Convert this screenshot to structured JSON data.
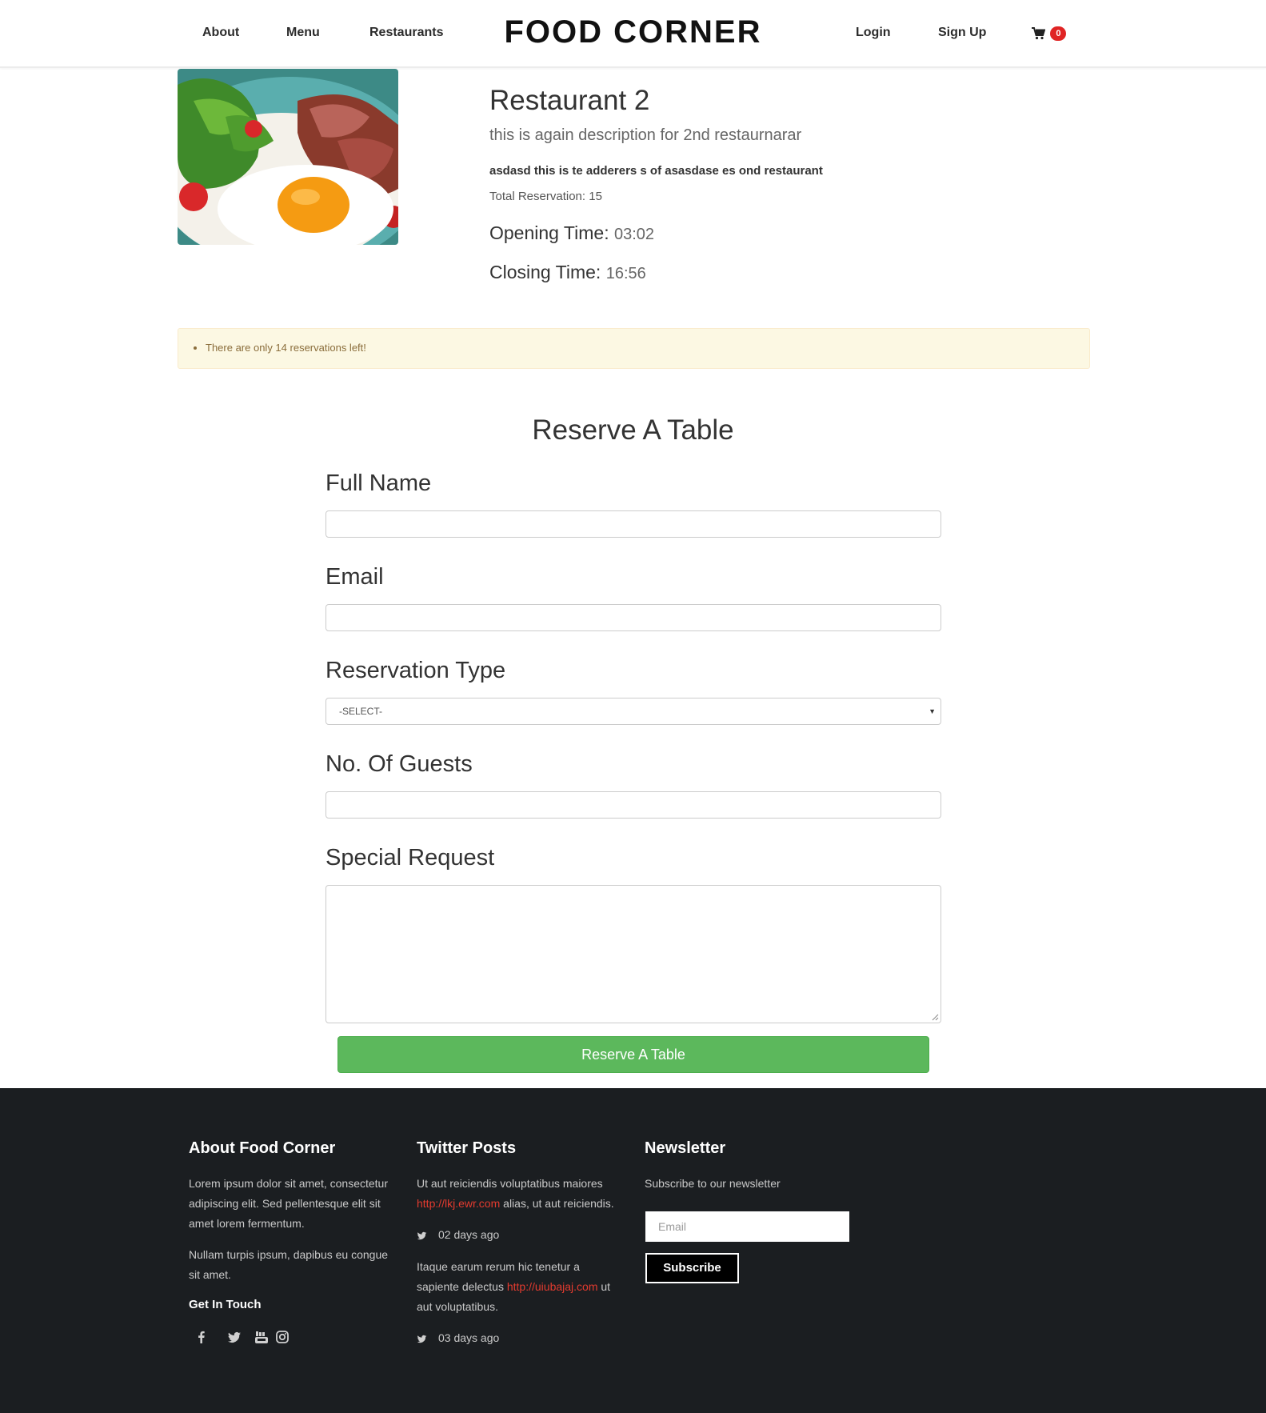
{
  "header": {
    "brand": "FOOD CORNER",
    "nav": {
      "about": "About",
      "menu": "Menu",
      "restaurants": "Restaurants",
      "login": "Login",
      "signup": "Sign Up"
    },
    "cart_count": "0"
  },
  "restaurant": {
    "name": "Restaurant 2",
    "description": "this is again description for 2nd restaurnarar",
    "address": "asdasd this is te adderers s of asasdase es ond restaurant",
    "total_reservation": "Total Reservation: 15",
    "opening_label": "Opening Time:",
    "opening_value": "03:02",
    "closing_label": "Closing Time:",
    "closing_value": "16:56"
  },
  "alert": {
    "message": "There are only 14 reservations left!"
  },
  "form": {
    "title": "Reserve A Table",
    "full_name_label": "Full Name",
    "email_label": "Email",
    "reservation_type_label": "Reservation Type",
    "reservation_type_value": "-SELECT-",
    "guests_label": "No. Of Guests",
    "special_request_label": "Special Request",
    "submit_label": "Reserve A Table"
  },
  "footer": {
    "about": {
      "heading": "About Food Corner",
      "p1": "Lorem ipsum dolor sit amet, consectetur adipiscing elit. Sed pellentesque elit sit amet lorem fermentum.",
      "p2": "Nullam turpis ipsum, dapibus eu congue sit amet.",
      "get_in_touch": "Get In Touch"
    },
    "twitter": {
      "heading": "Twitter Posts",
      "posts": [
        {
          "before": "Ut aut reiciendis voluptatibus maiores",
          "link": "http://lkj.ewr.com",
          "after": "alias, ut aut reiciendis.",
          "time": "02 days ago"
        },
        {
          "before": "Itaque earum rerum hic tenetur a sapiente delectus",
          "link": "http://uiubajaj.com",
          "after": "ut aut voluptatibus.",
          "time": "03 days ago"
        }
      ]
    },
    "newsletter": {
      "heading": "Newsletter",
      "text": "Subscribe to our newsletter",
      "email_placeholder": "Email",
      "subscribe_label": "Subscribe"
    },
    "social_icons": [
      "facebook-icon",
      "twitter-icon",
      "youtube-icon",
      "instagram-icon"
    ]
  },
  "colors": {
    "accent_green": "#5cb85c",
    "badge_red": "#e02424",
    "alert_bg": "#fcf8e3",
    "footer_bg": "#1b1e21",
    "link_red": "#e33b2f"
  }
}
